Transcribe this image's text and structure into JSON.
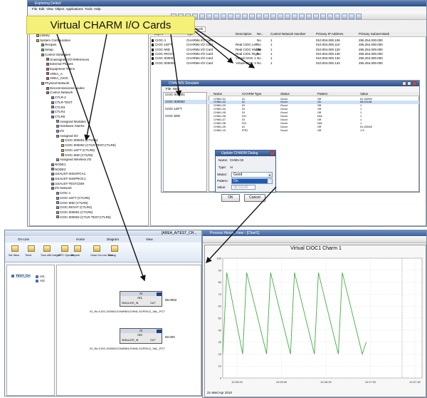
{
  "callout": {
    "text": "Virtual CHARM I/O Cards"
  },
  "explorer": {
    "title": "Exploring DeltaV",
    "menu": [
      "File",
      "Edit",
      "View",
      "Object",
      "Applications",
      "Tools",
      "Help"
    ],
    "tab": "Control Network",
    "tree": [
      {
        "label": "Library",
        "depth": 1
      },
      {
        "label": "System Configuration",
        "depth": 1
      },
      {
        "label": "Recipes",
        "depth": 2
      },
      {
        "label": "Setup",
        "depth": 2
      },
      {
        "label": "Control Strategies",
        "depth": 2
      },
      {
        "label": "Unassigned I/O References",
        "depth": 3
      },
      {
        "label": "External Phases",
        "depth": 3
      },
      {
        "label": "Equipment Trains",
        "depth": 3
      },
      {
        "label": "AREA_A",
        "depth": 3
      },
      {
        "label": "AREA_CIOC",
        "depth": 3
      },
      {
        "label": "Physical Network",
        "depth": 2
      },
      {
        "label": "Decommissioned Nodes",
        "depth": 3
      },
      {
        "label": "Control Network",
        "depth": 3
      },
      {
        "label": "CTLR-2",
        "depth": 4
      },
      {
        "label": "CTLR-TEST",
        "depth": 4
      },
      {
        "label": "CTLR3",
        "depth": 4
      },
      {
        "label": "CTLR4",
        "depth": 4
      },
      {
        "label": "CTLR5",
        "depth": 4
      },
      {
        "label": "Assigned Modules",
        "depth": 5
      },
      {
        "label": "Hardware Alarms",
        "depth": 5
      },
      {
        "label": "I/O",
        "depth": 5
      },
      {
        "label": "Assigned I/O",
        "depth": 5
      },
      {
        "label": "CIOC-000001 (CTLR5)",
        "depth": 6
      },
      {
        "label": "CIOC-000002 (CTLR-TEST,CTLR5)",
        "depth": 6
      },
      {
        "label": "CIOC-LEFT (CTLR5)",
        "depth": 6
      },
      {
        "label": "CIOC-MID (CTLR5)",
        "depth": 6
      },
      {
        "label": "Assigned Wireless I/O",
        "depth": 5
      },
      {
        "label": "NODE1",
        "depth": 4
      },
      {
        "label": "NODE2",
        "depth": 4
      },
      {
        "label": "USAUST-ISISOPCA1",
        "depth": 4
      },
      {
        "label": "USAUST-ISISPROC1",
        "depth": 4
      },
      {
        "label": "USAUST-TEST2349",
        "depth": 4
      },
      {
        "label": "I/O Network",
        "depth": 4
      },
      {
        "label": "CIOC-1",
        "depth": 5
      },
      {
        "label": "CIOC-LEFT (CTLR5)",
        "depth": 5
      },
      {
        "label": "CIOC-MID (CTLR5)",
        "depth": 5
      },
      {
        "label": "CIOC-RIGHT (CTLR4)",
        "depth": 5
      },
      {
        "label": "CIOC-000001 (CTLR5)",
        "depth": 5
      },
      {
        "label": "CIOC-000002 (CTLR-TEST,CTLR5)",
        "depth": 5
      }
    ],
    "columns": [
      "Object",
      "Type",
      "Description",
      "Ne...",
      "Control Network Number",
      "Primary IP Address",
      "Primary Subnet Mask"
    ],
    "rows": [
      [
        "CIOC-1",
        "CHARMs I/O Card",
        "",
        "No",
        "1",
        "010.004.000.106",
        "255.254.000.000"
      ],
      [
        "CIOC-LEFT",
        "CHARMs I/O Card",
        "Real CIOC Left",
        "No",
        "1",
        "010.004.000.110",
        "255.254.000.000"
      ],
      [
        "CIOC-MID",
        "CHARMs I/O Card",
        "Real CIOC Middle",
        "No",
        "1",
        "010.004.000.120",
        "255.254.000.000"
      ],
      [
        "CIOC-RIGHT",
        "CHARMs I/O Card",
        "Real CIOC Right",
        "No",
        "1",
        "010.004.000.130",
        "255.254.000.000"
      ],
      [
        "CIOC-000001",
        "CHARMs I/O Card",
        "Virtual CIOC 1",
        "No",
        "1",
        "010.004.000.130",
        "255.254.000.000"
      ],
      [
        "CIOC-000002",
        "CHARMs I/O Card",
        "Virtual CIOC 2",
        "No",
        "1",
        "010.004.000.134",
        "255.254.000.000"
      ]
    ]
  },
  "simulate": {
    "title": "CHARMS Simulate",
    "menu": [
      "File",
      "Help"
    ],
    "list": [
      "CIOC-000001",
      "CIOC-000002",
      "CIOC-LEFT",
      "CIOC-MID"
    ],
    "columns": [
      "Name",
      "CHARM Type",
      "Status",
      "Pattern",
      "Value"
    ],
    "rows": [
      [
        "CHM1-01",
        "AI",
        "Good",
        "Off",
        "61.00099"
      ],
      [
        "CHM1-02",
        "AI",
        "Good",
        "On",
        "58.01146"
      ],
      [
        "CHM1-03",
        "DI",
        "Good",
        "Off",
        "1"
      ],
      [
        "CHM1-04",
        "DI",
        "Good",
        "Off",
        "1"
      ],
      [
        "CHM1-05",
        "DI",
        "Good",
        "Off",
        "1"
      ],
      [
        "CHM1-06",
        "DO",
        "Good",
        "N/A",
        "1"
      ],
      [
        "CHM1-07",
        "DI",
        "Good",
        "Off",
        "1"
      ],
      [
        "CHM1-08",
        "DO",
        "Good",
        "N/A",
        "1"
      ],
      [
        "CHM1-09",
        "AI",
        "Good",
        "Off",
        "51.00048"
      ],
      [
        "CHM1-10",
        "RTD",
        "Good",
        "Off",
        "1.5"
      ]
    ]
  },
  "dialog": {
    "title": "Update CHARM Dialog",
    "name_label": "Name:",
    "name_value": "CHM1-02",
    "type_label": "Type:",
    "type_value": "AI",
    "status_label": "Status:",
    "status_value": "Good",
    "pattern_label": "Pattern:",
    "pattern_value": "On",
    "value_label": "Value:",
    "value_value": "58.01146",
    "ok": "OK",
    "cancel": "Cancel"
  },
  "studio": {
    "title": "[AREA_A/TEST_CH...",
    "ribbon_tabs": [
      "On-Line",
      "Home",
      "Diagram",
      "View"
    ],
    "ribbon_buttons": [
      "Set Value",
      "Trend",
      "Tune with Insight",
      "MPC Operate",
      "Repeat",
      "Close On-Line View",
      "Debug"
    ],
    "tree": [
      "TEST_CH",
      "AI1",
      "AI2"
    ],
    "blocks": [
      {
        "hdr": "AI",
        "sub": "AI1",
        "in": "SIMULATE_IN",
        "out": "OUT",
        "val": "58.0052",
        "tag": "IO_IN=CIOC-000001/CHARM1/CHM1-01/FIELD_VAL_PCT"
      },
      {
        "hdr": "AI",
        "sub": "AI2",
        "in": "SIMULATE_IN",
        "out": "OUT",
        "val": "50.000",
        "tag": "IO_IN=CIOC-000002/CHARM1/CHM1-01/FIELD_VAL_PCT"
      }
    ]
  },
  "trend": {
    "title": "Process History View - [Chart1]",
    "chart_title": "Virtual CIOC1 Charm 1",
    "date_label": "21-Wed Apr 2010",
    "x_ticks": [
      "10:05:00",
      "10:06:00",
      "10:06:30",
      "10:07:00",
      "10:07:30"
    ],
    "y_ticks": [
      "100",
      "90",
      "80",
      "70",
      "60",
      "50",
      "40",
      "30",
      "20",
      "10",
      "0"
    ],
    "line_color": "#3fae3f"
  },
  "chart_data": {
    "type": "line",
    "title": "Virtual CIOC1 Charm 1",
    "xlabel": "",
    "ylabel": "",
    "ylim": [
      0,
      100
    ],
    "x_ticks": [
      "10:05:00",
      "10:06:00",
      "10:06:30",
      "10:07:00",
      "10:07:30"
    ],
    "series": [
      {
        "x": [
          0,
          0.02,
          0.1,
          0.12,
          0.22,
          0.24,
          0.34,
          0.36,
          0.46,
          0.48,
          0.58,
          0.6,
          0.7,
          0.72
        ],
        "y": [
          20,
          88,
          20,
          88,
          20,
          88,
          20,
          88,
          20,
          88,
          20,
          88,
          20,
          30
        ]
      }
    ],
    "grid": true
  }
}
